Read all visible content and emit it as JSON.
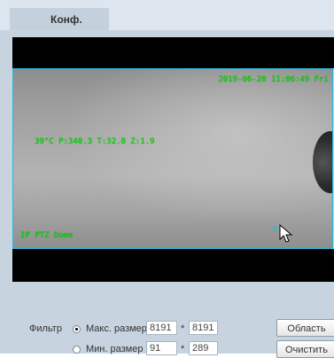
{
  "tabs": [
    {
      "label": "Конф."
    }
  ],
  "video": {
    "timestamp": "2019-06-20 11:06:49 Fri",
    "ptz_info": "39°C P:340.3 T:32.8 Z:1.9",
    "channel_name": "IP PTZ Dome",
    "roi_marker": "0"
  },
  "filter": {
    "label": "Фильтр",
    "max_size": {
      "label": "Макс. размер",
      "width": "8191",
      "height": "8191",
      "selected": true
    },
    "min_size": {
      "label": "Мин. размер",
      "width": "91",
      "height": "289",
      "selected": false
    },
    "separator": "*",
    "area_button": "Область",
    "clear_button": "Очистить"
  },
  "colors": {
    "panel_bg": "#c7d3df",
    "video_border": "#29b8de",
    "osd_text": "#0bcf0b"
  }
}
